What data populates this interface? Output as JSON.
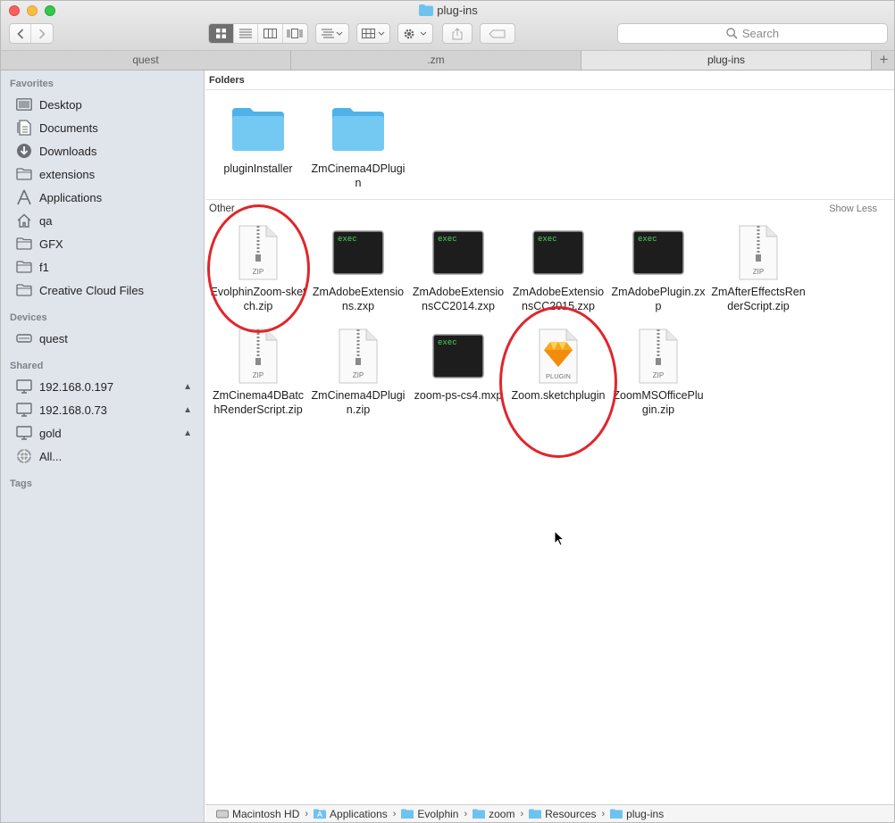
{
  "window": {
    "title": "plug-ins"
  },
  "toolbar": {
    "back_icon": "chevron-left-icon",
    "forward_icon": "chevron-right-icon",
    "search_placeholder": "Search"
  },
  "tabs": [
    {
      "label": "quest",
      "active": false
    },
    {
      "label": ".zm",
      "active": false
    },
    {
      "label": "plug-ins",
      "active": true
    }
  ],
  "sidebar": {
    "favorites_heading": "Favorites",
    "favorites": [
      {
        "label": "Desktop",
        "icon": "desktop-icon"
      },
      {
        "label": "Documents",
        "icon": "documents-icon"
      },
      {
        "label": "Downloads",
        "icon": "downloads-icon"
      },
      {
        "label": "extensions",
        "icon": "folder-icon"
      },
      {
        "label": "Applications",
        "icon": "applications-icon"
      },
      {
        "label": "qa",
        "icon": "home-icon"
      },
      {
        "label": "GFX",
        "icon": "folder-icon"
      },
      {
        "label": "f1",
        "icon": "folder-icon"
      },
      {
        "label": "Creative Cloud Files",
        "icon": "folder-icon"
      }
    ],
    "devices_heading": "Devices",
    "devices": [
      {
        "label": "quest",
        "icon": "drive-icon"
      }
    ],
    "shared_heading": "Shared",
    "shared": [
      {
        "label": "192.168.0.197",
        "icon": "display-icon"
      },
      {
        "label": "192.168.0.73",
        "icon": "display-icon"
      },
      {
        "label": "gold",
        "icon": "display-icon"
      },
      {
        "label": "All...",
        "icon": "network-icon"
      }
    ],
    "tags_heading": "Tags"
  },
  "content": {
    "folders_heading": "Folders",
    "other_heading": "Other",
    "show_less": "Show Less",
    "folders": [
      {
        "name": "pluginInstaller"
      },
      {
        "name": "ZmCinema4DPlugin"
      }
    ],
    "files": [
      {
        "name": "EvolphinZoom-sketch.zip",
        "kind": "zip",
        "badge": "ZIP"
      },
      {
        "name": "ZmAdobeExtensions.zxp",
        "kind": "exec",
        "badge": "exec"
      },
      {
        "name": "ZmAdobeExtensionsCC2014.zxp",
        "kind": "exec",
        "badge": "exec"
      },
      {
        "name": "ZmAdobeExtensionsCC2015.zxp",
        "kind": "exec",
        "badge": "exec"
      },
      {
        "name": "ZmAdobePlugin.zxp",
        "kind": "exec",
        "badge": "exec"
      },
      {
        "name": "ZmAfterEffectsRenderScript.zip",
        "kind": "zip",
        "badge": "ZIP"
      },
      {
        "name": "ZmCinema4DBatchRenderScript.zip",
        "kind": "zip",
        "badge": "ZIP"
      },
      {
        "name": "ZmCinema4DPlugin.zip",
        "kind": "zip",
        "badge": "ZIP"
      },
      {
        "name": "zoom-ps-cs4.mxp",
        "kind": "exec",
        "badge": "exec"
      },
      {
        "name": "Zoom.sketchplugin",
        "kind": "plugin",
        "badge": "PLUGIN"
      },
      {
        "name": "ZoomMSOfficePlugin.zip",
        "kind": "zip",
        "badge": "ZIP"
      }
    ]
  },
  "pathbar": [
    {
      "label": "Macintosh HD",
      "icon": "drive-icon"
    },
    {
      "label": "Applications",
      "icon": "applications-folder-icon"
    },
    {
      "label": "Evolphin",
      "icon": "folder-icon"
    },
    {
      "label": "zoom",
      "icon": "folder-icon"
    },
    {
      "label": "Resources",
      "icon": "folder-icon"
    },
    {
      "label": "plug-ins",
      "icon": "folder-icon"
    }
  ],
  "colors": {
    "annotation": "#e1252c",
    "folder": "#5fc1f0",
    "sidebar_bg": "#e0e5ec"
  }
}
